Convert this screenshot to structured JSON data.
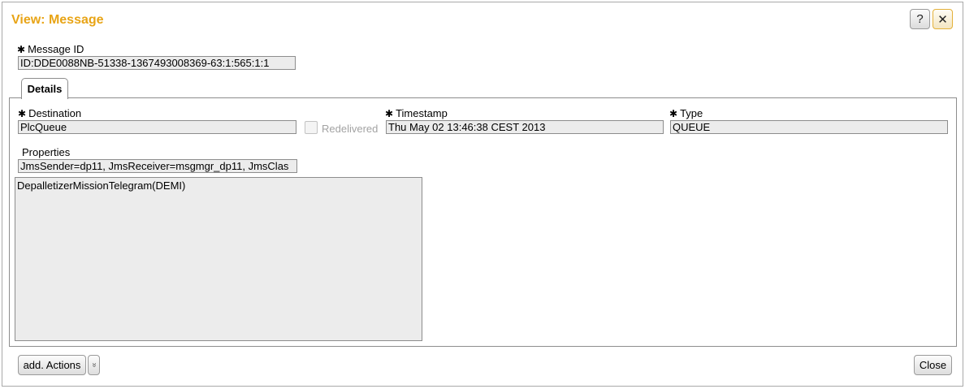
{
  "dialog": {
    "title": "View: Message",
    "help_label": "?",
    "close_icon_glyph": "✕"
  },
  "required_marker": "✱",
  "message_id": {
    "label": "Message ID",
    "value": "ID:DDE0088NB-51338-1367493008369-63:1:565:1:1"
  },
  "tabs": [
    {
      "label": "Details",
      "selected": true
    }
  ],
  "details": {
    "destination": {
      "label": "Destination",
      "value": "PlcQueue"
    },
    "redelivered": {
      "label": "Redelivered",
      "checked": false,
      "disabled": true
    },
    "timestamp": {
      "label": "Timestamp",
      "value": "Thu May 02 13:46:38 CEST 2013"
    },
    "type": {
      "label": "Type",
      "value": "QUEUE"
    },
    "properties": {
      "label": "Properties",
      "value": "JmsSender=dp11, JmsReceiver=msgmgr_dp11, JmsClas"
    },
    "body": "DepalletizerMissionTelegram(DEMI)"
  },
  "footer": {
    "actions_label": "add. Actions",
    "actions_dropdown_glyph": "»",
    "close_label": "Close"
  },
  "colors": {
    "title": "#e8a416",
    "field_bg": "#ececec",
    "border": "#8d8d8d"
  }
}
